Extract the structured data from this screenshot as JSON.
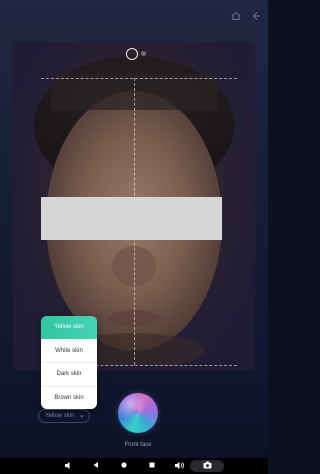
{
  "skin_menu": {
    "options": [
      "Yellow skin",
      "White skin",
      "Dark skin",
      "Brown skin"
    ],
    "selected_index": 0
  },
  "skin_select": {
    "value": "Yellow skin"
  },
  "shutter": {
    "label": "Front face"
  },
  "icons": {
    "home": "home-icon",
    "back": "back-arrow-icon",
    "camera_switch": "camera-lens-icon",
    "nav": [
      "volume-down-icon",
      "nav-back-icon",
      "nav-home-icon",
      "nav-recents-icon",
      "volume-up-icon",
      "screenshot-icon"
    ]
  },
  "colors": {
    "accent": "#2fc5a3",
    "background": "#171f36"
  }
}
